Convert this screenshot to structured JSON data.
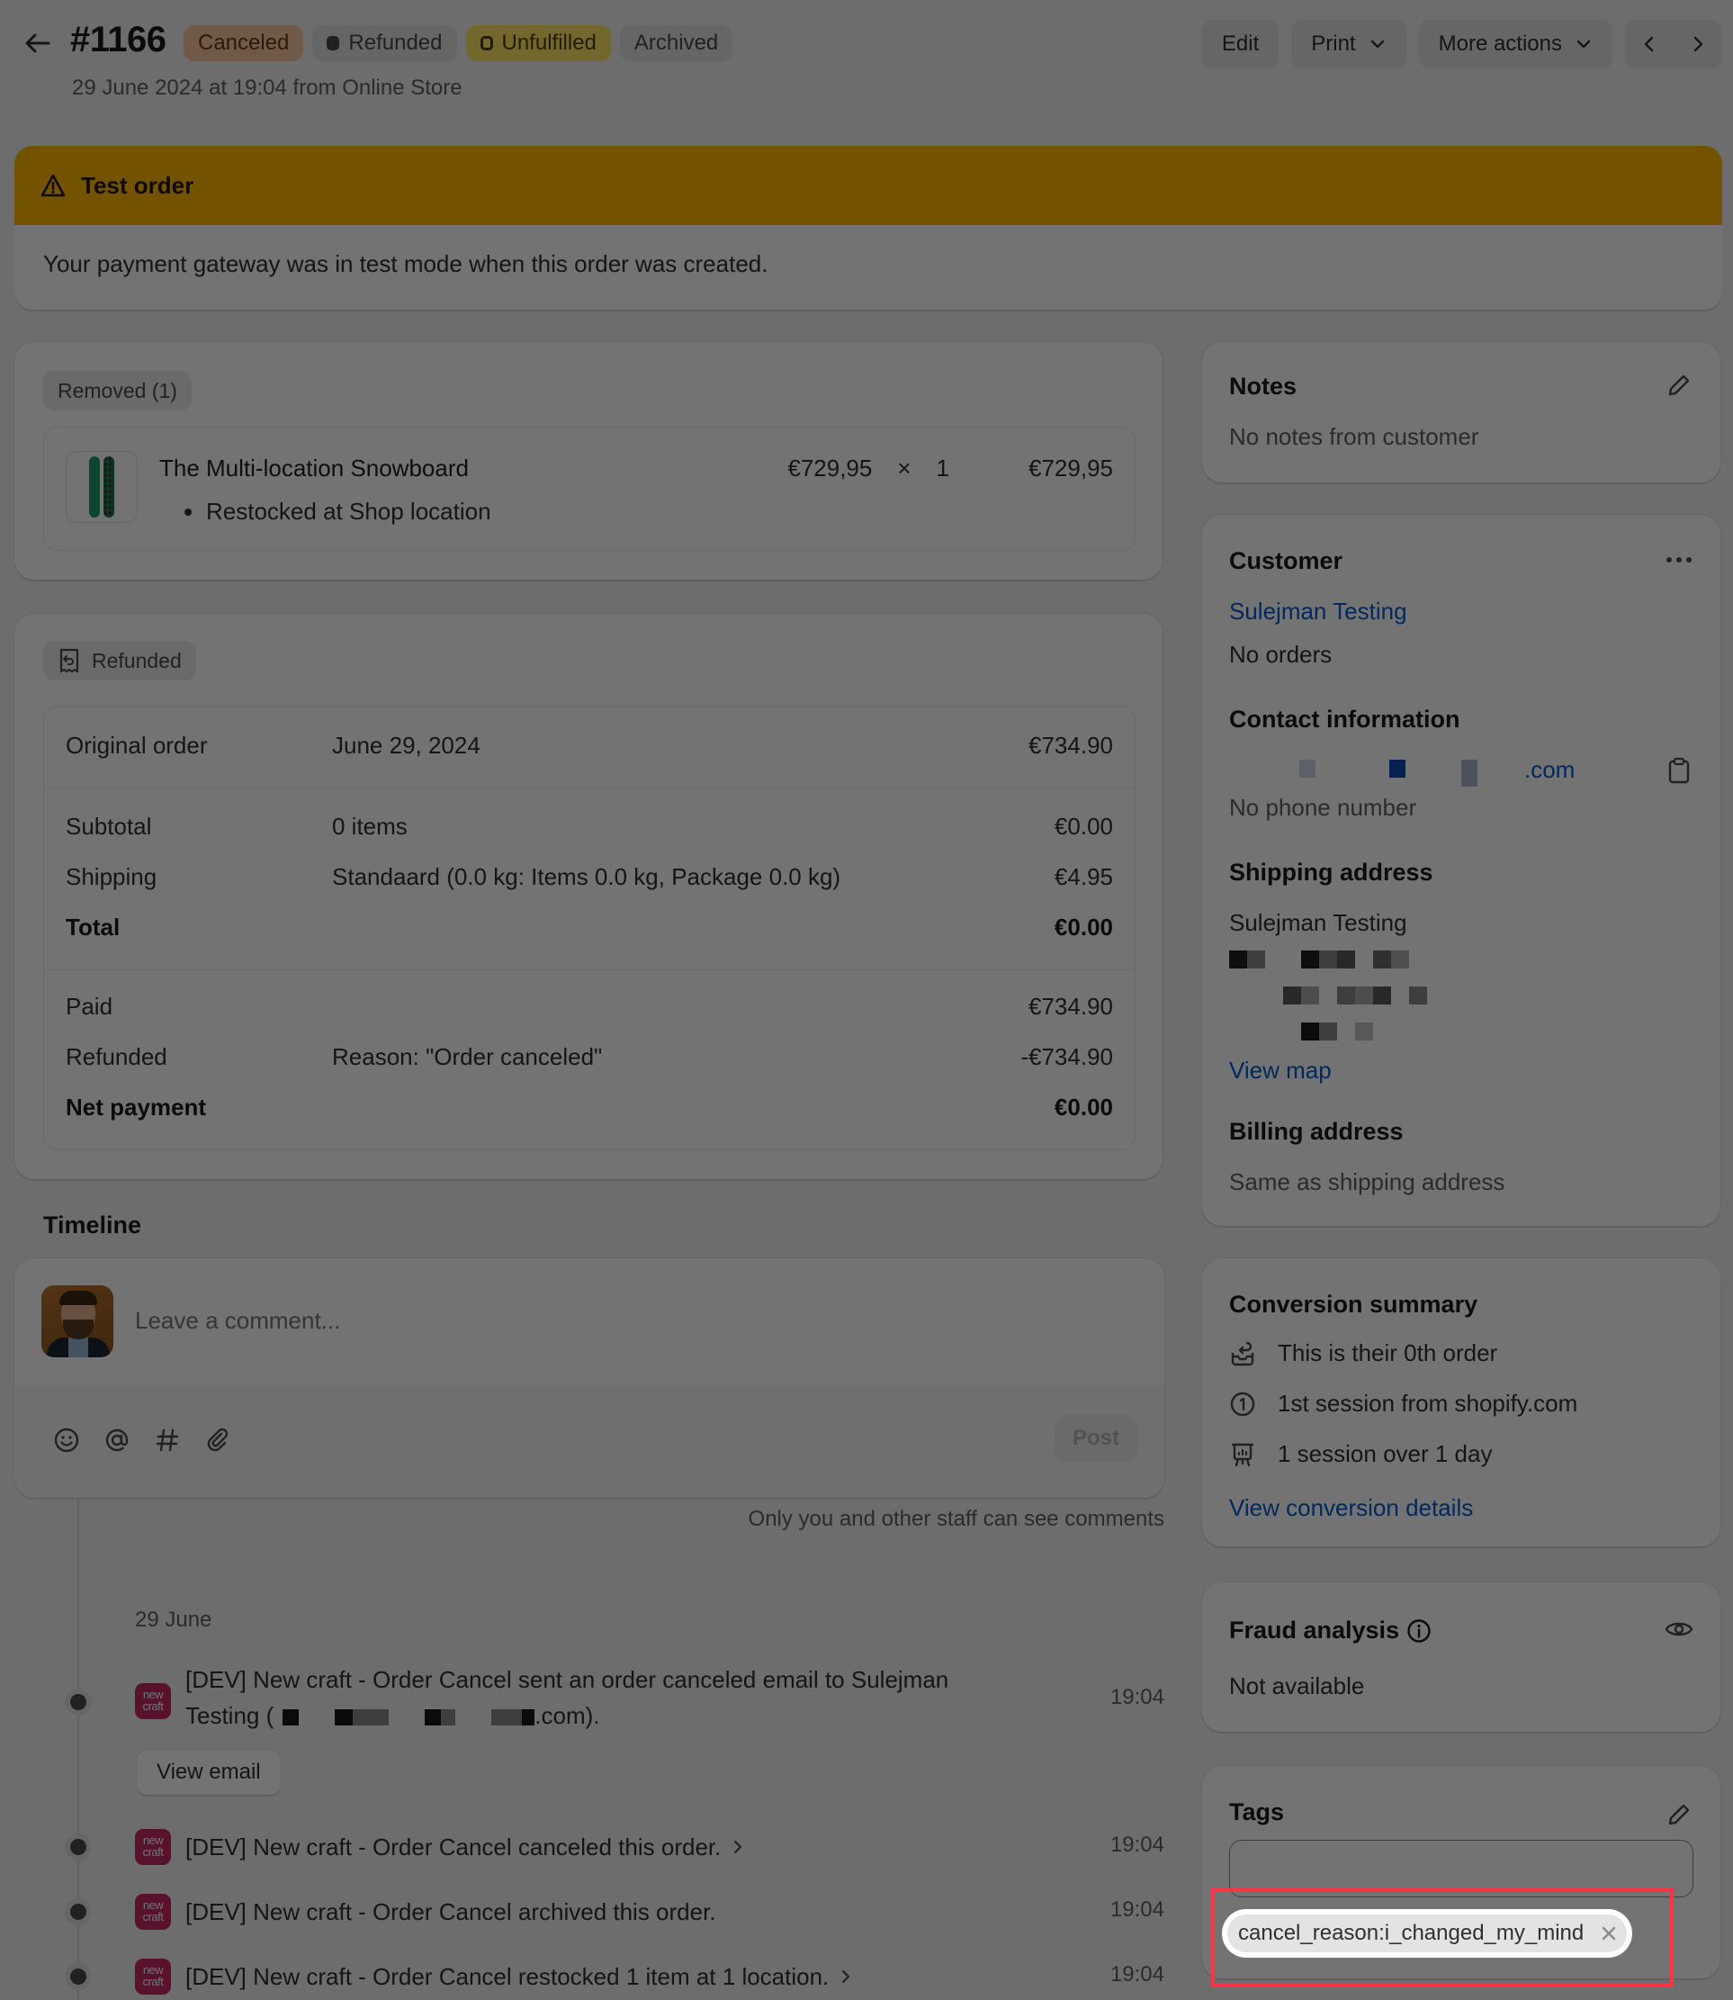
{
  "header": {
    "order_number": "#1166",
    "subtitle": "29 June 2024 at 19:04 from Online Store",
    "badges": [
      {
        "label": "Canceled",
        "style": "canceled"
      },
      {
        "label": "Refunded",
        "style": "neutral-dot"
      },
      {
        "label": "Unfulfilled",
        "style": "unfulfilled-ring"
      },
      {
        "label": "Archived",
        "style": "neutral"
      }
    ],
    "actions": {
      "edit": "Edit",
      "print": "Print",
      "more_actions": "More actions"
    },
    "icons": {
      "back": "arrow-left-icon",
      "prev": "chevron-left-icon",
      "next": "chevron-right-icon"
    }
  },
  "banner": {
    "title": "Test order",
    "icon": "warning-triangle-icon",
    "message": "Your payment gateway was in test mode when this order was created.",
    "accent_color": "#ffb800"
  },
  "removed": {
    "label": "Removed (1)",
    "item": {
      "name": "The Multi-location Snowboard",
      "unit_price": "€729,95",
      "times": "×",
      "quantity": "1",
      "total": "€729,95",
      "note": "Restocked at Shop location"
    }
  },
  "refund": {
    "label": "Refunded",
    "icon": "receipt-refund-icon",
    "rows": [
      {
        "label": "Original order",
        "detail": "June 29, 2024",
        "amount": "€734.90",
        "bold": false
      },
      {
        "label": "Subtotal",
        "detail": "0 items",
        "amount": "€0.00",
        "bold": false
      },
      {
        "label": "Shipping",
        "detail": "Standaard (0.0 kg: Items 0.0 kg, Package 0.0 kg)",
        "amount": "€4.95",
        "bold": false
      },
      {
        "label": "Total",
        "detail": "",
        "amount": "€0.00",
        "bold": true
      },
      {
        "label": "Paid",
        "detail": "",
        "amount": "€734.90",
        "bold": false
      },
      {
        "label": "Refunded",
        "detail": "Reason: \"Order canceled\"",
        "amount": "-€734.90",
        "bold": false
      },
      {
        "label": "Net payment",
        "detail": "",
        "amount": "€0.00",
        "bold": true
      }
    ]
  },
  "timeline": {
    "title": "Timeline",
    "comment_placeholder": "Leave a comment...",
    "post_label": "Post",
    "staff_note": "Only you and other staff can see comments",
    "tools": [
      "emoji-icon",
      "mention-icon",
      "hashtag-icon",
      "attachment-icon"
    ],
    "date_label": "29 June",
    "events": [
      {
        "text_before": "[DEV] New craft - Order Cancel sent an order canceled email to Sulejman Testing (",
        "text_after": ".com).",
        "time": "19:04",
        "has_chevron": false,
        "button": "View email"
      },
      {
        "text": "[DEV] New craft - Order Cancel canceled this order.",
        "time": "19:04",
        "has_chevron": true
      },
      {
        "text": "[DEV] New craft - Order Cancel archived this order.",
        "time": "19:04",
        "has_chevron": false
      },
      {
        "text": "[DEV] New craft - Order Cancel restocked 1 item at 1 location.",
        "time": "19:04",
        "has_chevron": true
      }
    ],
    "app_icon_text": [
      "new",
      "craft"
    ],
    "app_color": "#c4285f"
  },
  "notes": {
    "title": "Notes",
    "text": "No notes from customer"
  },
  "customer": {
    "title": "Customer",
    "name": "Sulejman Testing",
    "orders": "No orders",
    "contact_title": "Contact information",
    "email_suffix": ".com",
    "phone": "No phone number",
    "shipping_title": "Shipping address",
    "shipping_name": "Sulejman Testing",
    "view_map": "View map",
    "billing_title": "Billing address",
    "billing_text": "Same as shipping address"
  },
  "conversion": {
    "title": "Conversion summary",
    "rows": [
      {
        "icon": "order-return-icon",
        "text": "This is their 0th order"
      },
      {
        "icon": "number-one-circle-icon",
        "text": "1st session from shopify.com"
      },
      {
        "icon": "chart-board-icon",
        "text": "1 session over 1 day"
      }
    ],
    "link": "View conversion details"
  },
  "fraud": {
    "title": "Fraud analysis",
    "text": "Not available"
  },
  "tags": {
    "title": "Tags",
    "input_value": "",
    "chips": [
      {
        "label": "cancel_reason:i_changed_my_mind"
      }
    ],
    "highlight_color": "#ff3344"
  }
}
